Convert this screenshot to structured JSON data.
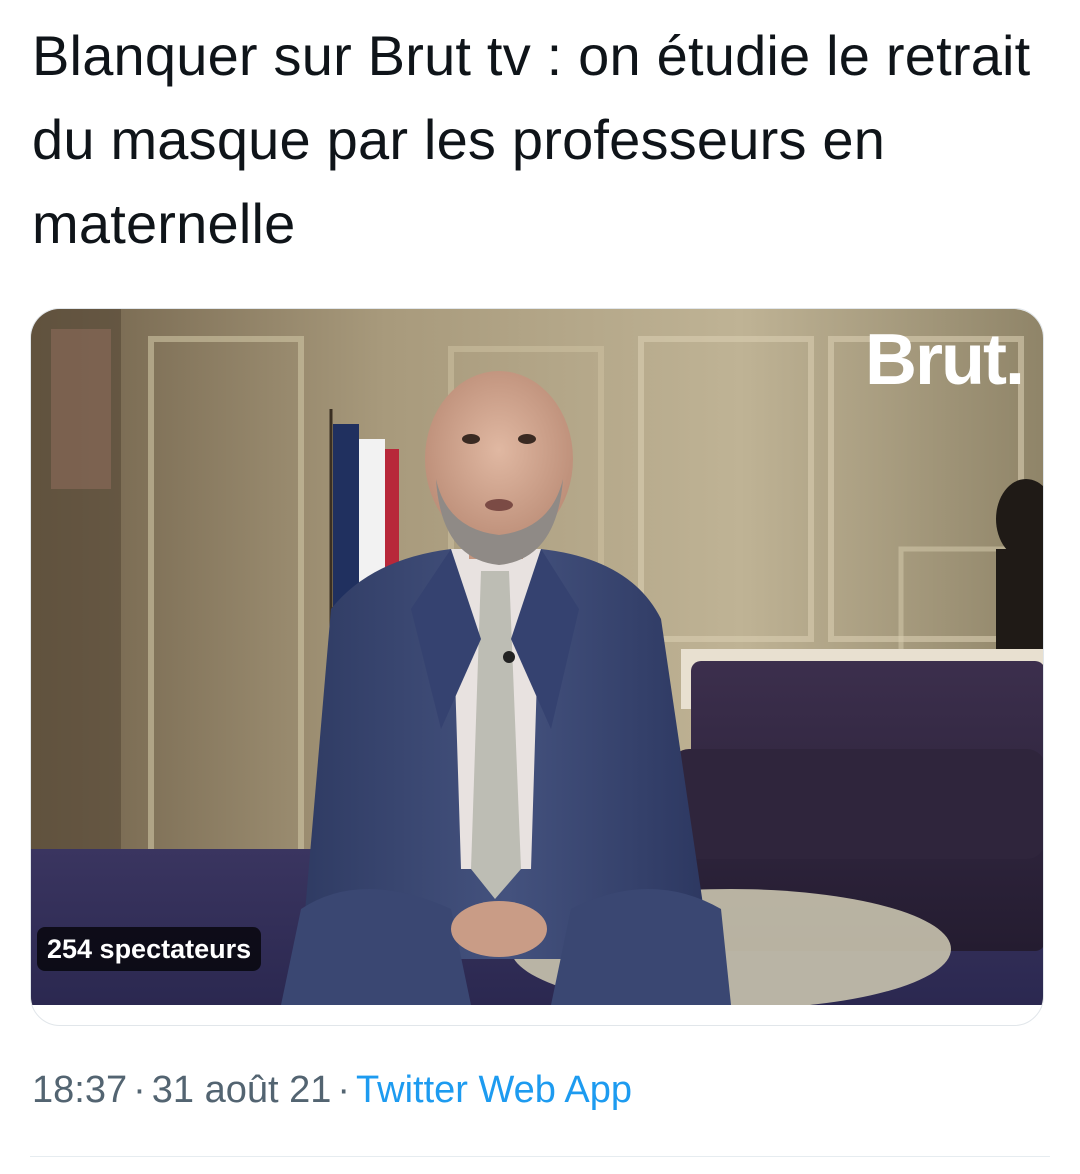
{
  "tweet": {
    "text": "Blanquer sur Brut tv : on étudie le retrait du masque par les professeurs en maternelle"
  },
  "media": {
    "logo_text": "Brut.",
    "viewers_label": "254 spectateurs"
  },
  "meta": {
    "time": "18:37",
    "separator": "·",
    "date": "31 août 21",
    "source": "Twitter Web App"
  },
  "colors": {
    "text": "#0f1419",
    "secondary": "#536471",
    "link": "#1d9bf0"
  }
}
